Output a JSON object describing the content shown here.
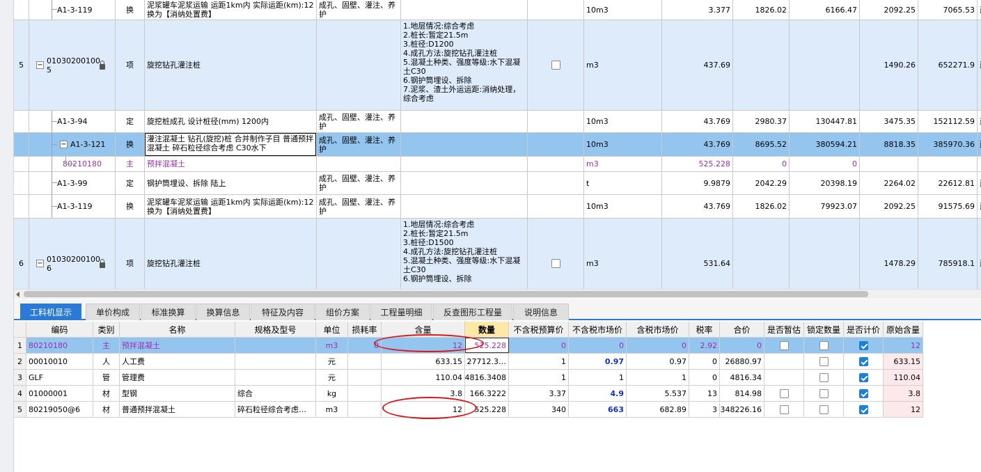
{
  "top_grid": {
    "rows": [
      {
        "num": "",
        "code": "A1-3-119",
        "type": "换",
        "name": "泥浆罐车泥浆运输 运距1km内  实际运距(km):12  换为【消纳处置费】",
        "spec": "成孔、固壁、灌注、养护",
        "feature": "",
        "unit": "10m3",
        "qty": "3.377",
        "price": "1826.02",
        "total": "6166.47",
        "unit_price": "2092.25",
        "sum": "7065.53",
        "extra": "建筑"
      },
      {
        "num": "5",
        "code": "01030200100 5",
        "type": "项",
        "name": "旋挖钻孔灌注桩",
        "spec": "",
        "feature": "1.地层情况:综合考虑\n2.桩长:暂定21.5m\n3.桩径:D1200\n4.成孔方法:旋挖钻孔灌注桩\n5.混凝土种类、强度等级:水下混凝土C30\n6.钢护筒埋设、拆除\n7.泥浆、渣土外运运距:消纳处理，综合考虑",
        "unit": "m3",
        "qty": "437.69",
        "price": "",
        "total": "",
        "unit_price": "1490.26",
        "sum": "652271.9",
        "extra": "建筑"
      },
      {
        "num": "",
        "code": "A1-3-94",
        "type": "定",
        "name": "旋挖桩成孔 设计桩径(mm) 1200内",
        "spec": "成孔、固壁、灌注、养护",
        "feature": "",
        "unit": "10m3",
        "qty": "43.769",
        "price": "2980.37",
        "total": "130447.81",
        "unit_price": "3475.35",
        "sum": "152112.59",
        "extra": "建筑"
      },
      {
        "num": "",
        "code": "A1-3-121",
        "type": "换",
        "name": "灌注混凝土 钻孔(旋挖)桩  合并制作子目 普通预拌混凝土 碎石粒径综合考虑 C30水下",
        "spec": "成孔、固壁、灌注、养护",
        "feature": "",
        "unit": "10m3",
        "qty": "43.769",
        "price": "8695.52",
        "total": "380594.21",
        "unit_price": "8818.35",
        "sum": "385970.36",
        "extra": "建筑"
      },
      {
        "num": "",
        "code": "80210180",
        "type": "主",
        "name": "预拌混凝土",
        "spec": "",
        "feature": "",
        "unit": "m3",
        "qty": "525.228",
        "price": "0",
        "total": "0",
        "unit_price": "",
        "sum": "",
        "extra": ""
      },
      {
        "num": "",
        "code": "A1-3-99",
        "type": "定",
        "name": "钢护筒埋设、拆除 陆上",
        "spec": "成孔、固壁、灌注、养护",
        "feature": "",
        "unit": "t",
        "qty": "9.9879",
        "price": "2042.29",
        "total": "20398.19",
        "unit_price": "2264.02",
        "sum": "22612.81",
        "extra": "建筑"
      },
      {
        "num": "",
        "code": "A1-3-119",
        "type": "换",
        "name": "泥浆罐车泥浆运输 运距1km内  实际运距(km):12  换为【消纳处置费】",
        "spec": "成孔、固壁、灌注、养护",
        "feature": "",
        "unit": "10m3",
        "qty": "43.769",
        "price": "1826.02",
        "total": "79923.07",
        "unit_price": "2092.25",
        "sum": "91575.69",
        "extra": "建筑"
      },
      {
        "num": "6",
        "code": "01030200100 6",
        "type": "项",
        "name": "旋挖钻孔灌注桩",
        "spec": "",
        "feature": "1.地层情况:综合考虑\n2.桩长:暂定21.5m\n3.桩径:D1500\n4.成孔方法:旋挖钻孔灌注桩\n5.混凝土种类、强度等级:水下混凝土C30\n6.钢护筒埋设、拆除",
        "unit": "m3",
        "qty": "531.64",
        "price": "",
        "total": "",
        "unit_price": "1478.29",
        "sum": "785918.1",
        "extra": "建筑"
      }
    ]
  },
  "tabs": [
    "工料机显示",
    "单价构成",
    "标准换算",
    "换算信息",
    "特征及内容",
    "组价方案",
    "工程量明细",
    "反查图形工程量",
    "说明信息"
  ],
  "bottom_grid": {
    "headers": [
      "编码",
      "类别",
      "名称",
      "规格及型号",
      "单位",
      "损耗率",
      "含量",
      "数量",
      "不含税预算价",
      "不含税市场价",
      "含税市场价",
      "税率",
      "合价",
      "是否暂估",
      "锁定数量",
      "是否计价",
      "原始含量"
    ],
    "rows": [
      {
        "num": "1",
        "code": "80210180",
        "cat": "主",
        "name": "预拌混凝土",
        "spec": "",
        "unit": "m3",
        "loss": "0",
        "content": "12",
        "qty": "525.228",
        "pre_budget": "0",
        "pre_market": "0",
        "tax_market": "0",
        "rate": "2.92",
        "total": "0",
        "tmp": false,
        "lock": false,
        "priced": true,
        "orig": "12"
      },
      {
        "num": "2",
        "code": "00010010",
        "cat": "人",
        "name": "人工费",
        "spec": "",
        "unit": "元",
        "loss": "",
        "content": "633.15",
        "qty": "27712.3…",
        "pre_budget": "1",
        "pre_market": "0.97",
        "tax_market": "0.97",
        "rate": "0",
        "total": "26880.97",
        "tmp": null,
        "lock": false,
        "priced": true,
        "orig": "633.15"
      },
      {
        "num": "3",
        "code": "GLF",
        "cat": "管",
        "name": "管理费",
        "spec": "",
        "unit": "元",
        "loss": "",
        "content": "110.04",
        "qty": "4816.3408",
        "pre_budget": "1",
        "pre_market": "1",
        "tax_market": "1",
        "rate": "0",
        "total": "4816.34",
        "tmp": null,
        "lock": false,
        "priced": true,
        "orig": "110.04"
      },
      {
        "num": "4",
        "code": "01000001",
        "cat": "材",
        "name": "型钢",
        "spec": "综合",
        "unit": "kg",
        "loss": "",
        "content": "3.8",
        "qty": "166.3222",
        "pre_budget": "3.37",
        "pre_market": "4.9",
        "tax_market": "5.537",
        "rate": "13",
        "total": "814.98",
        "tmp": false,
        "lock": false,
        "priced": true,
        "orig": "3.8"
      },
      {
        "num": "5",
        "code": "80219050@6",
        "cat": "材",
        "name": "普通预拌混凝土",
        "spec": "碎石粒径综合考虑…",
        "unit": "m3",
        "loss": "",
        "content": "12",
        "qty": "525.228",
        "pre_budget": "340",
        "pre_market": "663",
        "tax_market": "682.89",
        "rate": "3",
        "total": "348226.16",
        "tmp": false,
        "lock": false,
        "priced": true,
        "orig": "12"
      }
    ]
  },
  "colors": {
    "accent": "#2b7bd6",
    "selected_row": "#93c5ef",
    "item_row": "#deebfb",
    "annotation": "#d8161b",
    "main_material_text": "#9b2fb5"
  }
}
